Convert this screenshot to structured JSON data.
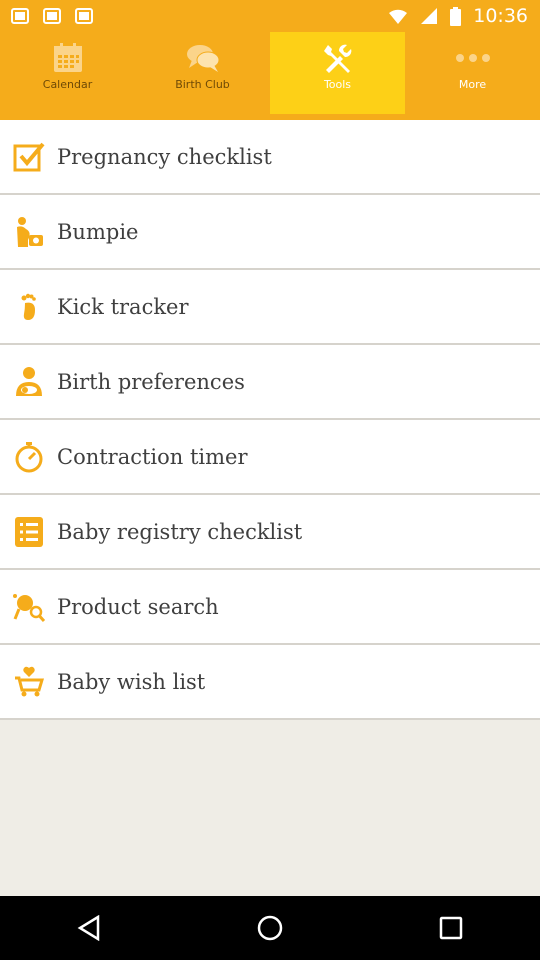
{
  "status_bar": {
    "time": "10:36"
  },
  "tabs": [
    {
      "label": "Calendar",
      "icon": "calendar-icon",
      "active": false
    },
    {
      "label": "Birth Club",
      "icon": "chat-bubbles-icon",
      "active": false
    },
    {
      "label": "Tools",
      "icon": "tools-icon",
      "active": true
    },
    {
      "label": "More",
      "icon": "more-dots-icon",
      "active": false
    }
  ],
  "tools_list": [
    {
      "label": "Pregnancy checklist",
      "icon": "checkbox-icon"
    },
    {
      "label": "Bumpie",
      "icon": "bump-camera-icon"
    },
    {
      "label": "Kick tracker",
      "icon": "footprint-icon"
    },
    {
      "label": "Birth preferences",
      "icon": "mother-baby-icon"
    },
    {
      "label": "Contraction timer",
      "icon": "stopwatch-icon"
    },
    {
      "label": "Baby registry checklist",
      "icon": "list-icon"
    },
    {
      "label": "Product search",
      "icon": "rattle-search-icon"
    },
    {
      "label": "Baby wish list",
      "icon": "cart-heart-icon"
    }
  ],
  "colors": {
    "accent": "#f5ac1b",
    "active_tab": "#fdd017",
    "icon": "#f5ac1b",
    "text": "#3f3f3f"
  }
}
